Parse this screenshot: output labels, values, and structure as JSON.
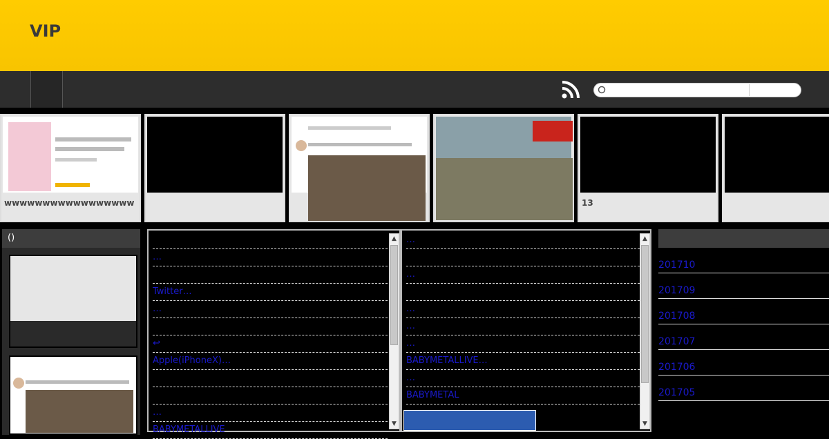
{
  "site": {
    "title": "VIP"
  },
  "search": {
    "placeholder": "",
    "value": ""
  },
  "strip": [
    {
      "caption": "wwwwwwwwwwwwwwwww",
      "kind": "image"
    },
    {
      "caption": "",
      "kind": "black"
    },
    {
      "caption": "",
      "kind": "image"
    },
    {
      "caption": "",
      "kind": "image"
    },
    {
      "caption": "13",
      "kind": "black"
    },
    {
      "caption": "",
      "kind": "black"
    }
  ],
  "sidebar": {
    "heading": "()"
  },
  "feed_left": [
    "",
    "…",
    "",
    "Twitter…",
    "…",
    "",
    "↩",
    "Apple(iPhoneX)…",
    "",
    "",
    "…",
    "BABYMETALLIVE"
  ],
  "feed_right": [
    "…",
    "",
    "…",
    "",
    "…",
    "…",
    "…",
    "BABYMETALLIVE…",
    "…",
    "BABYMETAL"
  ],
  "archive": [
    "201710",
    "201709",
    "201708",
    "201707",
    "201706",
    "201705"
  ],
  "colors": {
    "header": "#ffcc00",
    "nav": "#2d2d2d",
    "link": "#1a1acc"
  }
}
